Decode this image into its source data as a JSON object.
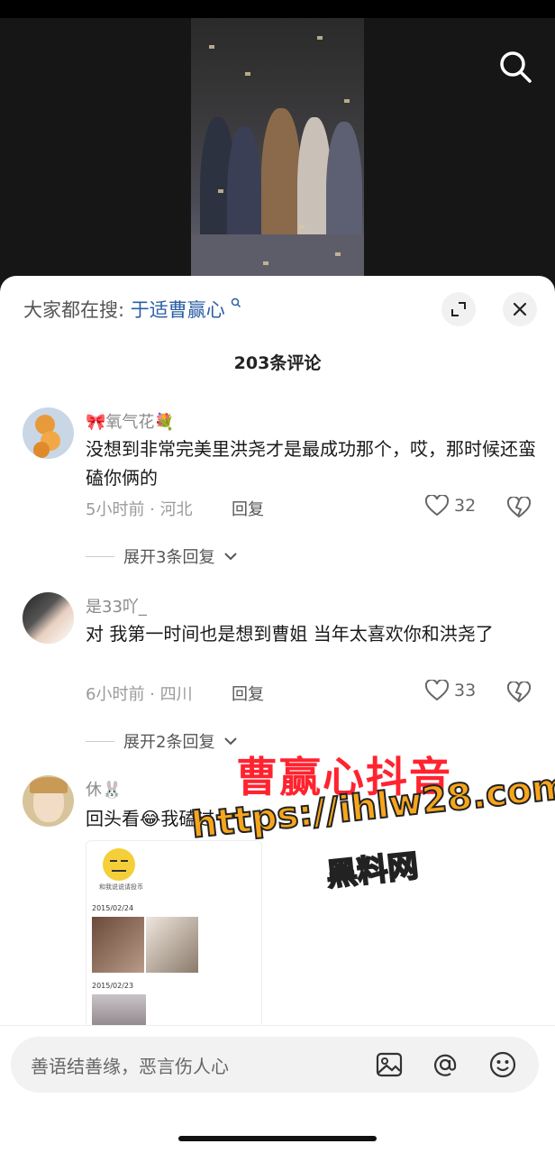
{
  "video": {
    "search_icon": "search-icon"
  },
  "sheet": {
    "everyone_label": "大家都在搜:",
    "everyone_keyword": "于适曹赢心",
    "comment_count": "203条评论"
  },
  "comments": [
    {
      "username": "🎀氧气花💐",
      "text": "没想到非常完美里洪尧才是最成功那个，哎，那时候还蛮磕你俩的",
      "time_location": "5小时前 · 河北",
      "reply": "回复",
      "likes": "32",
      "expand": "展开3条回复"
    },
    {
      "username": "是33吖_",
      "text": "对 我第一时间也是想到曹姐 当年太喜欢你和洪尧了",
      "time_location": "6小时前 · 四川",
      "reply": "回复",
      "likes": "33",
      "expand": "展开2条回复"
    },
    {
      "username": "休🐰",
      "text": "回头看😂我磕过",
      "image": {
        "caption": "和我说说请投币",
        "date1": "2015/02/24",
        "date2": "2015/02/23"
      }
    }
  ],
  "watermark": {
    "line1": "曹赢心抖音",
    "line2": "https://ihlw28.com",
    "line3": "黑料网"
  },
  "input": {
    "placeholder": "善语结善缘，恶言伤人心",
    "icons": [
      "image-icon",
      "at-icon",
      "emoji-icon"
    ]
  }
}
